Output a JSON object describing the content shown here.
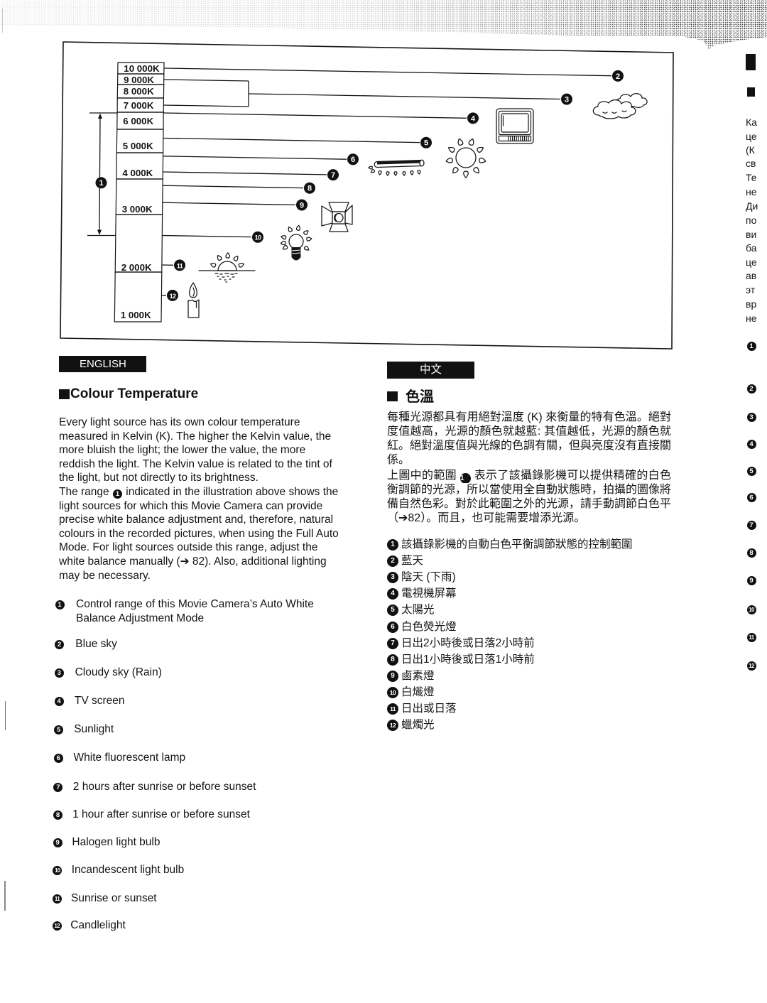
{
  "diagram": {
    "scale_labels": [
      "10 000K",
      "9 000K",
      "8 000K",
      "7 000K",
      "6 000K",
      "5 000K",
      "4 000K",
      "3 000K",
      "2 000K",
      "1 000K"
    ],
    "range_marker": {
      "number": "1",
      "kelvin_range": [
        2500,
        6500
      ]
    },
    "callouts": [
      {
        "number": "2",
        "kelvin": 10000
      },
      {
        "number": "3",
        "kelvin_range": [
          7000,
          9000
        ],
        "icon": "cloud"
      },
      {
        "number": "4",
        "kelvin": 6500,
        "icon": "tv-screen"
      },
      {
        "number": "5",
        "kelvin": 5300,
        "icon": "sun"
      },
      {
        "number": "6",
        "kelvin": 4600,
        "icon": "fluorescent-lamp"
      },
      {
        "number": "7",
        "kelvin": 4000
      },
      {
        "number": "8",
        "kelvin": 3600
      },
      {
        "number": "9",
        "kelvin": 3100,
        "icon": "halogen-lamp"
      },
      {
        "number": "10",
        "kelvin": 2500,
        "icon": "incandescent-bulb"
      },
      {
        "number": "11",
        "kelvin": 2000,
        "icon": "sunrise"
      },
      {
        "number": "12",
        "kelvin": 1400,
        "icon": "candle"
      }
    ]
  },
  "english": {
    "language_tab": "ENGLISH",
    "heading": "Colour Temperature",
    "body_lines": [
      "Every light source has its own colour temperature",
      "measured in Kelvin (K). The higher the Kelvin value, the",
      "more bluish the light; the lower the value, the more",
      "reddish the light. The Kelvin value is related to the tint of",
      "the light, but not directly to its brightness.",
      [
        "The range ",
        {
          "circle": "1"
        },
        " indicated in the illustration above shows the"
      ],
      "light sources for which this Movie Camera can provide",
      "precise white balance adjustment and, therefore, natural",
      "colours in the recorded pictures, when using the Full Auto",
      "Mode. For light sources outside this range, adjust the",
      "white balance manually (➔ 82). Also, additional lighting",
      "may be necessary."
    ],
    "legend": [
      {
        "number": "1",
        "text": "Control range of this Movie Camera’s Auto White Balance Adjustment Mode"
      },
      {
        "number": "2",
        "text": "Blue sky"
      },
      {
        "number": "3",
        "text": "Cloudy sky (Rain)"
      },
      {
        "number": "4",
        "text": "TV screen"
      },
      {
        "number": "5",
        "text": "Sunlight"
      },
      {
        "number": "6",
        "text": "White fluorescent lamp"
      },
      {
        "number": "7",
        "text": "2 hours after sunrise or before sunset"
      },
      {
        "number": "8",
        "text": "1 hour after sunrise or before sunset"
      },
      {
        "number": "9",
        "text": "Halogen light bulb"
      },
      {
        "number": "10",
        "text": "Incandescent light bulb"
      },
      {
        "number": "11",
        "text": "Sunrise or sunset"
      },
      {
        "number": "12",
        "text": "Candlelight"
      }
    ]
  },
  "chinese": {
    "language_tab": "中文",
    "heading": "色溫",
    "paragraphs": [
      [
        "每種光源都具有用絕對溫度 (K) 來衡量的特有色溫。絕對溫",
        "度值越高，光源的顏色就越藍: 其值越低，光源的顏色就越",
        "紅。絕對溫度值與光線的色調有關，但與亮度沒有直接關",
        "係。"
      ],
      [
        [
          "上圖中的範圍 ",
          {
            "circle": "1"
          },
          " 表示了該攝錄影機可以提供精確的白色平"
        ],
        "衡調節的光源，所以當使用全自動狀態時，拍攝的圖像將具",
        "備自然色彩。對於此範圍之外的光源，請手動調節白色平衡",
        "（➔82）。而且，也可能需要增添光源。"
      ]
    ],
    "legend": [
      {
        "number": "1",
        "text": "該攝錄影機的自動白色平衡調節狀態的控制範圍"
      },
      {
        "number": "2",
        "text": "藍天"
      },
      {
        "number": "3",
        "text": "陰天 (下雨)"
      },
      {
        "number": "4",
        "text": "電視機屏幕"
      },
      {
        "number": "5",
        "text": "太陽光"
      },
      {
        "number": "6",
        "text": "白色熒光燈"
      },
      {
        "number": "7",
        "text": "日出2小時後或日落2小時前"
      },
      {
        "number": "8",
        "text": "日出1小時後或日落1小時前"
      },
      {
        "number": "9",
        "text": "鹵素燈"
      },
      {
        "number": "10",
        "text": "白熾燈"
      },
      {
        "number": "11",
        "text": "日出或日落"
      },
      {
        "number": "12",
        "text": "蠟燭光"
      }
    ]
  },
  "adjacent_page": {
    "text_fragments": [
      "Ка",
      "це",
      "(К",
      "св",
      "Те",
      "не",
      "Ди",
      "по",
      "ви",
      "ба",
      "це",
      "ав",
      "эт",
      "вр",
      "не"
    ],
    "legend_numbers": [
      "1",
      "2",
      "3",
      "4",
      "5",
      "6",
      "7",
      "8",
      "9",
      "10",
      "11",
      "12"
    ]
  }
}
